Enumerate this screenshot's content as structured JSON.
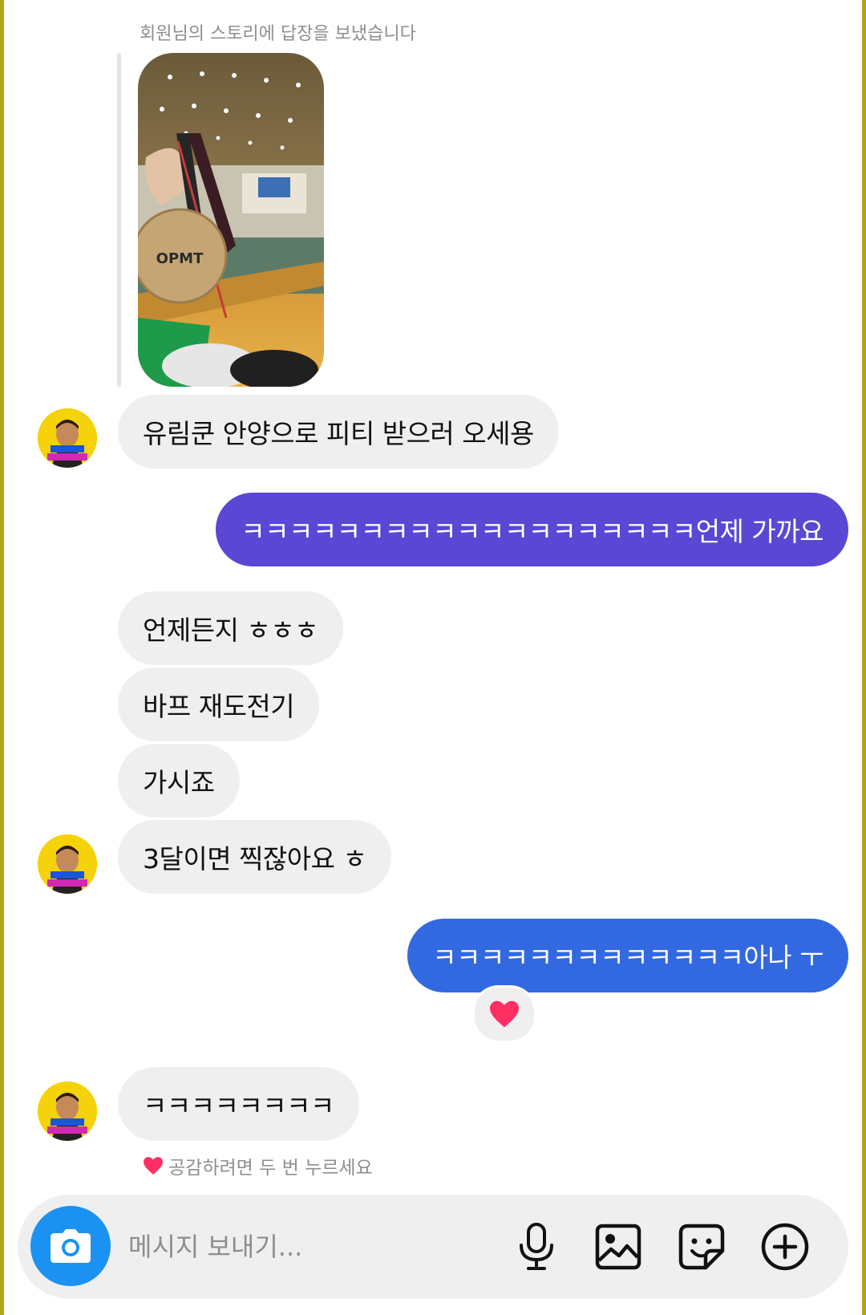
{
  "story_reply": {
    "caption": "회원님의 스토리에 답장을 보냈습니다",
    "image_icon": "story-photo-medal-icon"
  },
  "messages": [
    {
      "side": "received",
      "text": "유림쿤 안양으로 피티 받으러 오세용"
    },
    {
      "side": "sent",
      "text": "ㅋㅋㅋㅋㅋㅋㅋㅋㅋㅋㅋㅋㅋㅋㅋㅋㅋㅋㅋ언제 가까요",
      "color": "#5a47d4"
    },
    {
      "side": "received",
      "text": "언제든지 ㅎㅎㅎ"
    },
    {
      "side": "received",
      "text": "바프 재도전기"
    },
    {
      "side": "received",
      "text": "가시죠"
    },
    {
      "side": "received",
      "text": "3달이면 찍잖아요 ㅎ"
    },
    {
      "side": "sent",
      "text": "ㅋㅋㅋㅋㅋㅋㅋㅋㅋㅋㅋㅋㅋ아나 ㅜ",
      "color": "#3369e0",
      "reaction": "heart-icon"
    },
    {
      "side": "received",
      "text": "ㅋㅋㅋㅋㅋㅋㅋㅋ"
    }
  ],
  "hint": {
    "icon": "heart-icon",
    "text": "공감하려면 두 번 누르세요"
  },
  "composer": {
    "placeholder": "메시지 보내기...",
    "camera_icon": "camera-icon",
    "tools": [
      "microphone-icon",
      "gallery-icon",
      "sticker-icon",
      "plus-circle-icon"
    ]
  },
  "colors": {
    "received_bubble": "#efefef",
    "sent_purple": "#5a47d4",
    "sent_blue": "#3369e0",
    "camera_button": "#1b92f1",
    "avatar_bg": "#f5d20a"
  }
}
